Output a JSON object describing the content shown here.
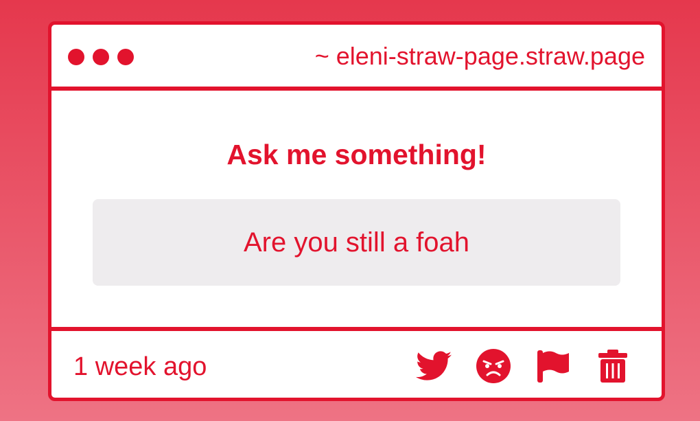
{
  "window": {
    "url": "~ eleni-straw-page.straw.page"
  },
  "main": {
    "heading": "Ask me something!",
    "question": "Are you still a foah"
  },
  "footer": {
    "timestamp": "1 week ago",
    "actions": [
      {
        "icon": "twitter-icon"
      },
      {
        "icon": "angry-face-icon"
      },
      {
        "icon": "flag-icon"
      },
      {
        "icon": "trash-icon"
      }
    ]
  },
  "colors": {
    "accent": "#e2132d",
    "question_bg": "#eeecee",
    "background_top": "#e5384d",
    "background_bottom": "#ee7384"
  }
}
